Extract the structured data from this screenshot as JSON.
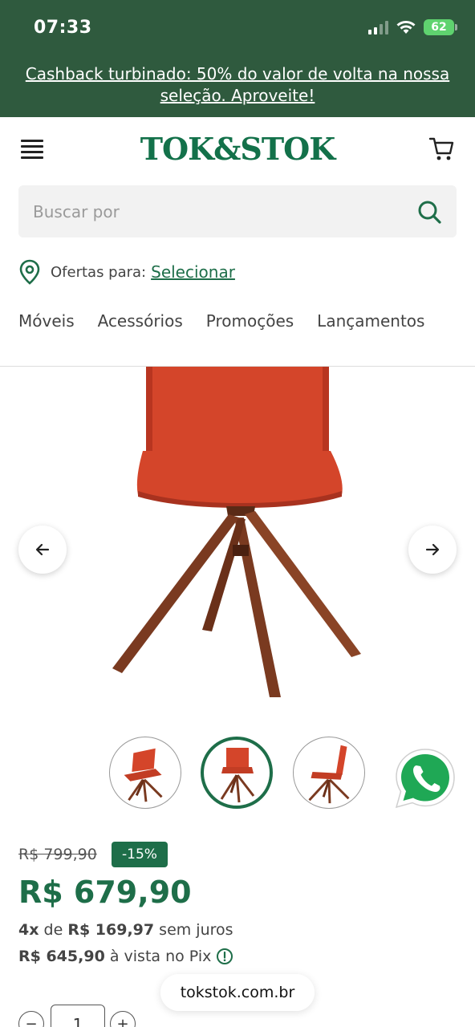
{
  "status_bar": {
    "time": "07:33",
    "battery": "62"
  },
  "promo": {
    "text": "Cashback turbinado: 50% do valor de volta na nossa seleção. Aproveite!"
  },
  "header": {
    "logo": "TOK&STOK"
  },
  "search": {
    "placeholder": "Buscar por"
  },
  "location": {
    "label": "Ofertas para:",
    "link": "Selecionar"
  },
  "nav": {
    "items": [
      "Móveis",
      "Acessórios",
      "Promoções",
      "Lançamentos"
    ]
  },
  "product": {
    "price_old": "R$ 799,90",
    "discount": "-15%",
    "price_now": "R$ 679,90",
    "installments_count": "4x",
    "installments_mid": "de",
    "installments_value": "R$ 169,97",
    "installments_suffix": "sem juros",
    "pix_value": "R$ 645,90",
    "pix_suffix": "à vista no Pix",
    "quantity": "1",
    "product_color": "#d4452a",
    "wood_color": "#7a3a20"
  },
  "browser": {
    "url": "tokstok.com.br"
  },
  "colors": {
    "brand_green": "#1e6e49",
    "header_green": "#2f5a3e"
  }
}
